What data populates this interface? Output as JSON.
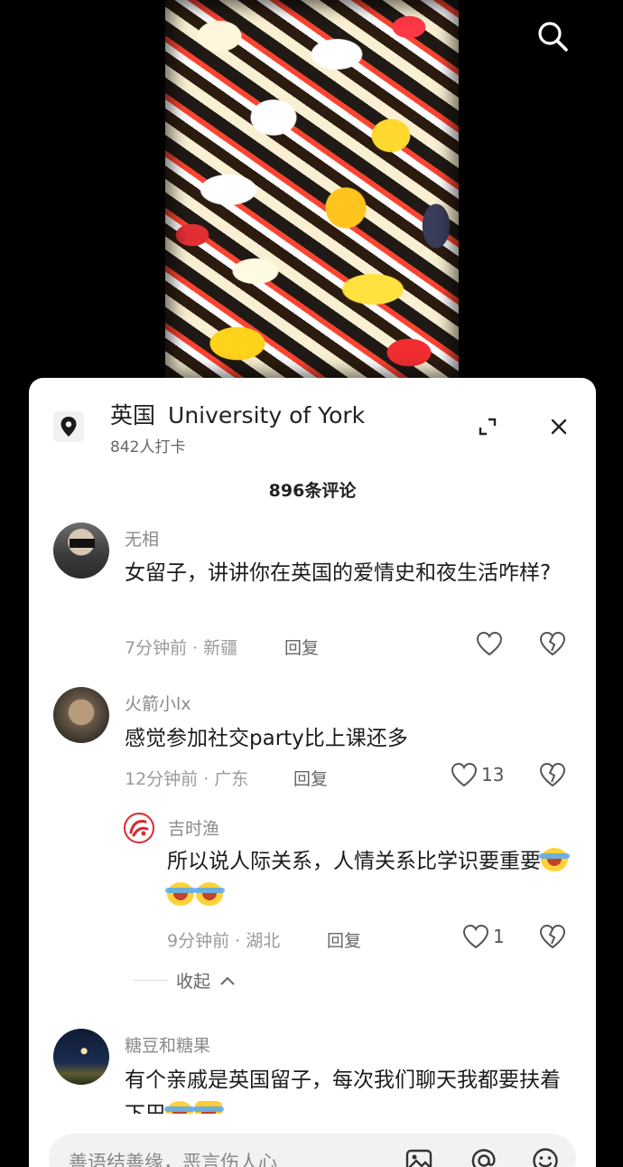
{
  "header": {
    "country": "英国",
    "place": "University of York",
    "checkins": "842人打卡",
    "comment_count": "896条评论"
  },
  "comments": [
    {
      "username": "无相",
      "text": "女留子，讲讲你在英国的爱情史和夜生活咋样?",
      "meta": "7分钟前 · 新疆",
      "reply_label": "回复",
      "likes": ""
    },
    {
      "username": "火箭小lx",
      "text": "感觉参加社交party比上课还多",
      "meta": "12分钟前 · 广东",
      "reply_label": "回复",
      "likes": "13"
    },
    {
      "username": "吉时渔",
      "text": "所以说人际关系，人情关系比学识要重要",
      "meta": "9分钟前 · 湖北",
      "reply_label": "回复",
      "likes": "1"
    },
    {
      "username": "糖豆和糖果",
      "text": "有个亲戚是英国留子，每次我们聊天我都要扶着下巴"
    }
  ],
  "collapse_label": "收起",
  "input": {
    "placeholder": "善语结善缘，恶言伤人心"
  },
  "icons": [
    "search-icon",
    "location-pin-icon",
    "expand-icon",
    "close-icon",
    "heart-icon",
    "broken-heart-icon",
    "chevron-up-icon",
    "image-icon",
    "at-icon",
    "emoji-icon"
  ],
  "colors": {
    "sheet_bg": "#ffffff",
    "meta_text": "#9a9a9a",
    "accent_red": "#d8282f"
  }
}
